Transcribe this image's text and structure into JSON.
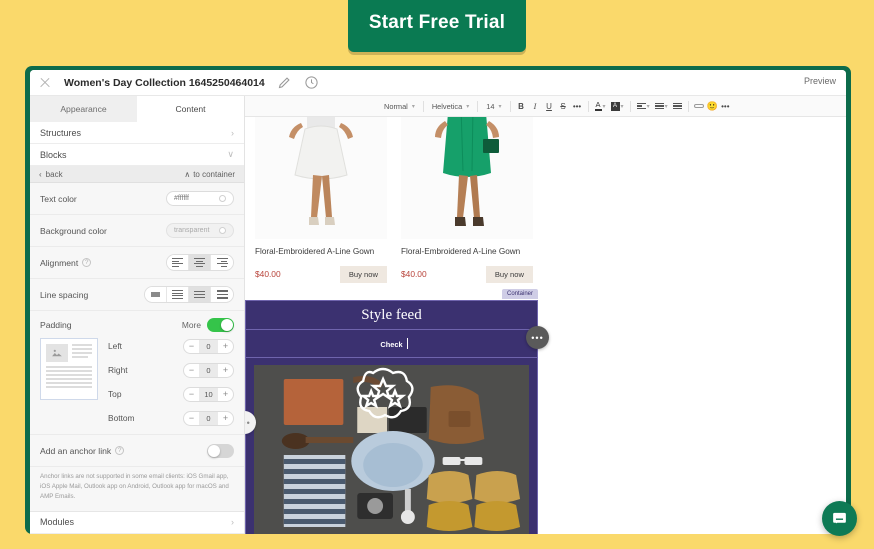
{
  "cta": {
    "label": "Start Free Trial",
    "color": "#0a7a52"
  },
  "window": {
    "title": "Women's Day Collection 1645250464014",
    "preview_label": "Preview",
    "icons": {
      "close": "close-icon",
      "edit": "pencil-icon",
      "history": "clock-icon"
    }
  },
  "sidebar": {
    "tabs": [
      {
        "label": "Appearance",
        "active": false
      },
      {
        "label": "Content",
        "active": true
      }
    ],
    "sections": [
      {
        "label": "Structures",
        "chevron": "›"
      },
      {
        "label": "Blocks",
        "chevron": "∨"
      }
    ],
    "back_bar": {
      "back_label": "back",
      "to_container_label": "to container",
      "back_chevron": "‹",
      "up_chevron": "∧"
    },
    "controls": {
      "text_color": {
        "label": "Text color",
        "value": "#ffffff"
      },
      "background_color": {
        "label": "Background color",
        "value": "transparent"
      },
      "alignment": {
        "label": "Alignment",
        "selected": 1,
        "options": [
          "align-left",
          "align-center",
          "align-right"
        ]
      },
      "line_spacing": {
        "label": "Line spacing",
        "selected": 2,
        "options": [
          "spacing-single",
          "spacing-compact",
          "spacing-normal",
          "spacing-wide"
        ]
      },
      "padding": {
        "label": "Padding",
        "more_label": "More",
        "more_on": true,
        "fields": [
          {
            "name": "Left",
            "value": "0"
          },
          {
            "name": "Right",
            "value": "0"
          },
          {
            "name": "Top",
            "value": "10"
          },
          {
            "name": "Bottom",
            "value": "0"
          }
        ]
      },
      "anchor": {
        "label": "Add an anchor link",
        "on": false,
        "note": "Anchor links are not supported in some email clients: iOS Gmail app, iOS Apple Mail, Outlook app on Android, Outlook app for macOS and AMP Emails."
      },
      "modules": {
        "label": "Modules",
        "chevron": "›"
      }
    }
  },
  "toolbar": {
    "style": "Normal",
    "font": "Helvetica",
    "size": "14",
    "caret": "▾",
    "buttons": [
      "B",
      "I",
      "U",
      "S",
      "•••"
    ],
    "more_label": "•••",
    "emoji": "🙂"
  },
  "email": {
    "products": [
      {
        "title": "Floral-Embroidered A-Line Gown",
        "price": "$40.00",
        "button": "Buy now"
      },
      {
        "title": "Floral-Embroidered A-Line Gown",
        "price": "$40.00",
        "button": "Buy now"
      }
    ],
    "feed": {
      "badge": "Container",
      "title": "Style feed",
      "subtitle": "Check"
    },
    "fab_label": "•••"
  },
  "chat": {
    "icon": "chat-message-icon",
    "color": "#0e7a55"
  }
}
